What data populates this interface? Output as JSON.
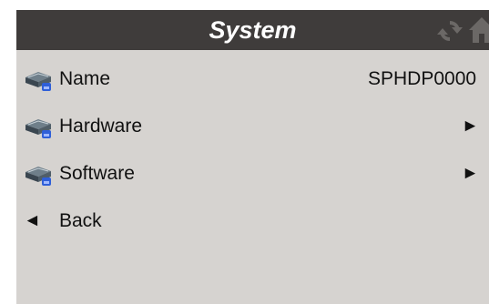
{
  "header": {
    "title": "System",
    "refresh_icon": "refresh-icon",
    "home_icon": "home-icon"
  },
  "menu": {
    "items": [
      {
        "label": "Name",
        "value": "SPHDP0000",
        "icon": "device-icon"
      },
      {
        "label": "Hardware",
        "arrow": "►",
        "icon": "device-icon"
      },
      {
        "label": "Software",
        "arrow": "►",
        "icon": "device-icon"
      }
    ],
    "back": {
      "arrow": "◄",
      "label": "Back"
    }
  },
  "colors": {
    "title_bar": "#3f3c3b",
    "panel_background": "#d6d3d0",
    "title_text": "#ffffff",
    "item_text": "#111111"
  }
}
